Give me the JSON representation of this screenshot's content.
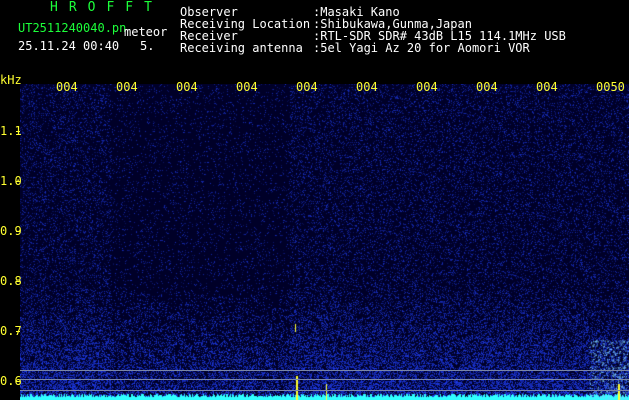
{
  "header": {
    "title": "HROFFT",
    "filename": "UT2511240040.pn",
    "type": "meteor",
    "datetime": "25.11.24 00:40",
    "marker": "5."
  },
  "info": {
    "labels": [
      "Observer",
      "Receiving Location",
      "Receiver",
      "Receiving antenna"
    ],
    "values": [
      ":Masaki Kano",
      ":Shibukawa,Gunma,Japan",
      ":RTL-SDR SDR# 43dB L15 114.1MHz USB",
      ":5el Yagi Az 20 for Aomori VOR"
    ]
  },
  "axes": {
    "y_unit": "kHz",
    "y_ticks": [
      "1.1",
      "1.0",
      "0.9",
      "0.8",
      "0.7",
      "0.6"
    ],
    "x_ticks": [
      "004",
      "004",
      "004",
      "004",
      "004",
      "004",
      "004",
      "004",
      "004",
      "0050"
    ]
  },
  "colors": {
    "text_green": "#1cff3a",
    "text_yellow": "#ffff30",
    "background": "#000000",
    "noise_base": "#050a30",
    "noise_strong": "#2a4cff",
    "signal": "#30ffff"
  }
}
